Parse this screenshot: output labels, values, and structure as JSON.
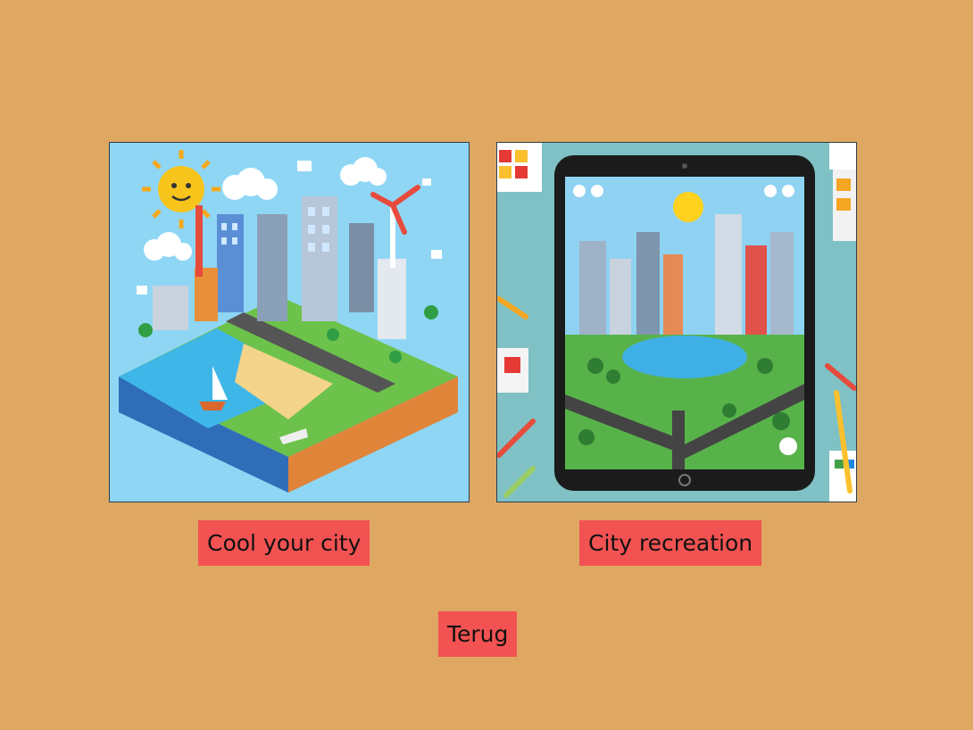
{
  "colors": {
    "background": "#dfa862",
    "button": "#f25252"
  },
  "tiles": [
    {
      "image": "isometric-city-island-illustration",
      "label": "Cool your city"
    },
    {
      "image": "tablet-city-park-illustration",
      "label": "City recreation"
    }
  ],
  "back_button": {
    "label": "Terug"
  }
}
